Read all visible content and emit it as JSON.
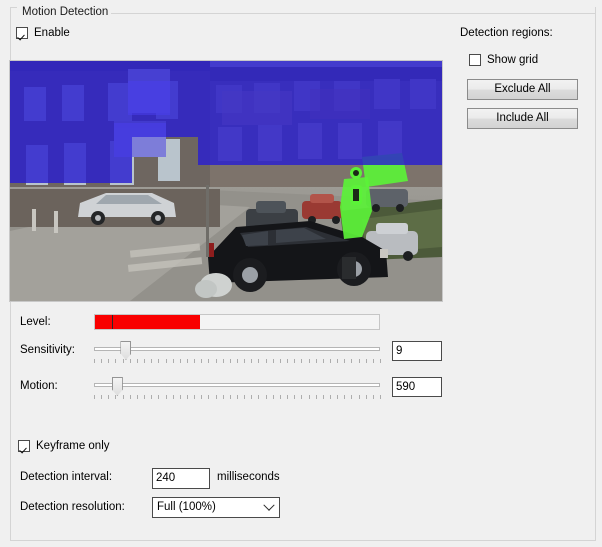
{
  "groupbox": {
    "legend": "Motion Detection"
  },
  "enable": {
    "label": "Enable",
    "checked": true
  },
  "regions": {
    "label": "Detection regions:",
    "show_grid_label": "Show grid",
    "show_grid_checked": false,
    "exclude_all_label": "Exclude All",
    "include_all_label": "Include All"
  },
  "preview": {
    "name": "motion-detection-video-preview",
    "excluded_region_color": "#2a1fd0",
    "motion_highlight_color": "#5bf238",
    "scene": "residential street with parked cars, brick terraced houses and a pedestrian"
  },
  "controls": {
    "level_label": "Level:",
    "level_percent": 37,
    "level_marker_percent": 6,
    "level_color": "#f90000",
    "sensitivity_label": "Sensitivity:",
    "sensitivity_value": "9",
    "sensitivity_percent": 11,
    "motion_label": "Motion:",
    "motion_value": "590",
    "motion_percent": 8
  },
  "options": {
    "keyframe_label": "Keyframe only",
    "keyframe_checked": true,
    "interval_label": "Detection interval:",
    "interval_value": "240",
    "interval_unit": "milliseconds",
    "resolution_label": "Detection resolution:",
    "resolution_value": "Full (100%)"
  }
}
